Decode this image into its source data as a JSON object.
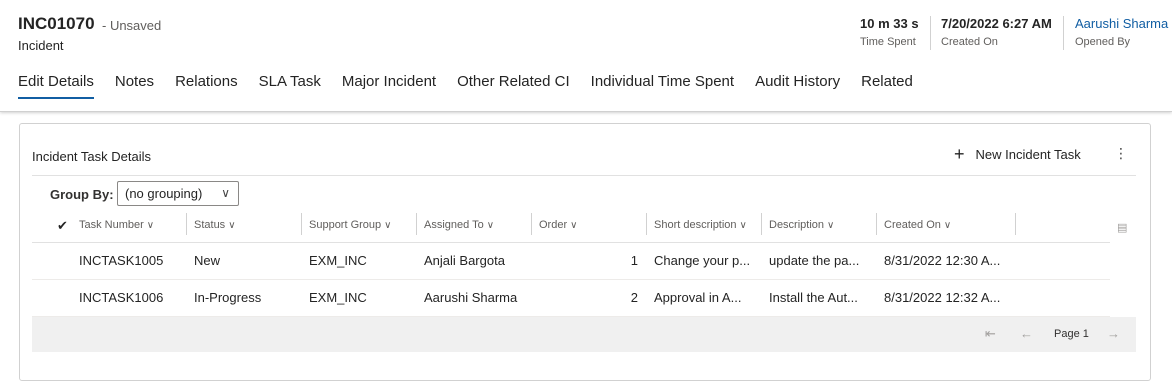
{
  "record": {
    "title": "INC01070",
    "save_state": "- Unsaved",
    "entity": "Incident"
  },
  "header_fields": {
    "time_spent": {
      "value": "10 m 33 s",
      "label": "Time Spent"
    },
    "created_on": {
      "value": "7/20/2022 6:27 AM",
      "label": "Created On"
    },
    "opened_by": {
      "value": "Aarushi Sharma",
      "label": "Opened By"
    }
  },
  "tabs": [
    {
      "label": "Edit Details",
      "active": true
    },
    {
      "label": "Notes"
    },
    {
      "label": "Relations"
    },
    {
      "label": "SLA Task"
    },
    {
      "label": "Major Incident"
    },
    {
      "label": "Other Related CI"
    },
    {
      "label": "Individual Time Spent"
    },
    {
      "label": "Audit History"
    },
    {
      "label": "Related"
    }
  ],
  "section": {
    "title": "Incident Task Details",
    "new_button": "New Incident Task",
    "group_by_label": "Group By:",
    "group_by_value": "(no grouping)"
  },
  "grid": {
    "columns": [
      "Task Number",
      "Status",
      "Support Group",
      "Assigned To",
      "Order",
      "Short description",
      "Description",
      "Created On"
    ],
    "rows": [
      [
        "INCTASK1005",
        "New",
        "EXM_INC",
        "Anjali Bargota",
        "1",
        "Change your p...",
        "update the pa...",
        "8/31/2022 12:30 A..."
      ],
      [
        "INCTASK1006",
        "In-Progress",
        "EXM_INC",
        "Aarushi Sharma",
        "2",
        "Approval in A...",
        "Install the Aut...",
        "8/31/2022 12:32 A..."
      ]
    ]
  },
  "pagination": {
    "page_label": "Page 1"
  },
  "icons": {
    "check_all": "checkmark-icon",
    "sort": "chevron-down-icon",
    "add": "plus-icon",
    "more": "more-vertical-icon",
    "first": "first-page-icon",
    "prev": "arrow-left-icon",
    "next": "arrow-right-icon"
  },
  "colors": {
    "accent": "#115ea3",
    "text": "#242424",
    "muted": "#605e5c",
    "footer_bg": "#f0f0f0"
  }
}
